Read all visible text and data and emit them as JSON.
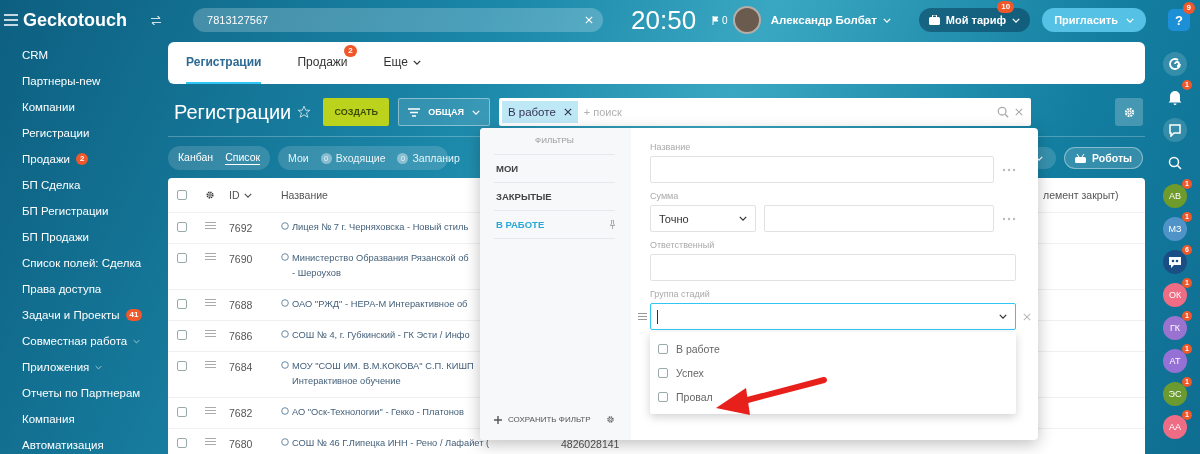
{
  "topbar": {
    "brand": "Geckotouch",
    "search": {
      "value": "7813127567"
    },
    "time": "20:50",
    "flag_count": "0",
    "user": "Александр Болбат",
    "tariff": {
      "label": "Мой тариф",
      "badge": "10"
    },
    "invite": "Пригласить",
    "help": {
      "label": "?",
      "badge": "9"
    }
  },
  "sidebar": {
    "items": [
      {
        "label": "CRM",
        "expandable": false
      },
      {
        "label": "Партнеры-new",
        "expandable": false
      },
      {
        "label": "Компании",
        "expandable": false
      },
      {
        "label": "Регистрации",
        "expandable": false
      },
      {
        "label": "Продажи",
        "badge": "2",
        "expandable": false
      },
      {
        "label": "БП Сделка",
        "expandable": false
      },
      {
        "label": "БП Регистрации",
        "expandable": false
      },
      {
        "label": "БП Продажи",
        "expandable": false
      },
      {
        "label": "Список полей: Сделка",
        "expandable": false
      },
      {
        "label": "Права доступа",
        "expandable": false
      },
      {
        "label": "Задачи и Проекты",
        "badge": "41",
        "expandable": false
      },
      {
        "label": "Совместная работа",
        "expandable": true
      },
      {
        "label": "Приложения",
        "expandable": true
      },
      {
        "label": "Отчеты по Партнерам",
        "expandable": false
      },
      {
        "label": "Компания",
        "expandable": false
      },
      {
        "label": "Автоматизация",
        "expandable": false
      }
    ]
  },
  "tabs": [
    {
      "label": "Регистрации",
      "selected": true,
      "kind": "tab"
    },
    {
      "label": "Продажи",
      "badge": "2",
      "selected": false,
      "kind": "tab"
    },
    {
      "label": "Еще",
      "selected": false,
      "kind": "menu"
    }
  ],
  "header": {
    "title": "Регистрации",
    "create_button": "СОЗДАТЬ",
    "filter_button": "ОБЩАЯ",
    "search": {
      "chip": "В работе",
      "placeholder": "+ поиск"
    }
  },
  "views": [
    {
      "label": "Канбан",
      "selected": false
    },
    {
      "label": "Список",
      "selected": true
    }
  ],
  "counters": [
    {
      "label": "Мои"
    },
    {
      "count": "0",
      "label": "Входящие"
    },
    {
      "count": "0",
      "label": "Запланир"
    }
  ],
  "robots_button": "Роботы",
  "table": {
    "all_selected": false,
    "columns": [
      {
        "label": "ID"
      },
      {
        "label": "Название"
      },
      {
        "label": "лемент закрыт)"
      }
    ],
    "rows": [
      {
        "selected": false,
        "id": "7692",
        "name": "Лицея № 7 г. Черняховска - Новый стиль"
      },
      {
        "selected": false,
        "id": "7690",
        "name": "Министерство Образвания Рязанской об",
        "name_line_2": "- Шероухов"
      },
      {
        "selected": false,
        "id": "7688",
        "name": "ОАО \"РЖД\" - НЕРА-М Интерактивное об"
      },
      {
        "selected": false,
        "id": "7686",
        "name": "СОШ № 4, г. Губкинский - ГК Эсти / Инфо"
      },
      {
        "selected": false,
        "id": "7684",
        "name": "МОУ \"СОШ ИМ. В.М.КОКОВА\" С.П. КИШП",
        "name_line_2": "Интерактивное обучение"
      },
      {
        "selected": false,
        "id": "7682",
        "name": "АО \"Оск-Технологии\" - Гекко - Платонов"
      },
      {
        "selected": false,
        "id": "7680",
        "name": "СОШ № 46 Г.Липецка ИНН - Рено / Лафайет (",
        "column_3": "4826028141"
      }
    ]
  },
  "filter_popup": {
    "heading": "ФИЛЬТРЫ",
    "presets": [
      {
        "label": "МОИ",
        "selected": false,
        "pinned": false
      },
      {
        "label": "ЗАКРЫТЫЕ",
        "selected": false,
        "pinned": false
      },
      {
        "label": "В РАБОТЕ",
        "selected": true,
        "pinned": true
      }
    ],
    "save_filter": "СОХРАНИТЬ ФИЛЬТР",
    "fields": [
      {
        "kind": "text",
        "label": "Название",
        "more": true
      },
      {
        "kind": "number",
        "label": "Сумма",
        "operator": "Точно",
        "more": true
      },
      {
        "kind": "text",
        "label": "Ответственный",
        "more": false
      },
      {
        "kind": "select",
        "label": "Группа стадий",
        "expanded": true,
        "options": [
          {
            "label": "В работе",
            "checked": false
          },
          {
            "label": "Успех",
            "checked": false
          },
          {
            "label": "Провал",
            "checked": false
          }
        ]
      }
    ]
  },
  "rail": [
    {
      "kind": "logo"
    },
    {
      "kind": "bell",
      "badge": "1"
    },
    {
      "kind": "chat"
    },
    {
      "kind": "search"
    },
    {
      "kind": "avatar",
      "initials": "АВ",
      "color": "#6f9a2c",
      "badge": "1"
    },
    {
      "kind": "avatar",
      "initials": "МЗ",
      "color": "#4f93c9",
      "badge": "1"
    },
    {
      "kind": "group",
      "badge": "6"
    },
    {
      "kind": "avatar",
      "initials": "ОК",
      "color": "#ee6c84",
      "badge": "1"
    },
    {
      "kind": "avatar",
      "initials": "ГК",
      "color": "#9a73d1",
      "badge": "1"
    },
    {
      "kind": "avatar",
      "initials": "АТ",
      "color": "#9571d6",
      "badge": "1"
    },
    {
      "kind": "avatar",
      "initials": "ЭС",
      "color": "#6a9a30",
      "badge": "1"
    },
    {
      "kind": "avatar",
      "initials": "АА",
      "color": "#ee6c84",
      "badge": "1"
    }
  ]
}
